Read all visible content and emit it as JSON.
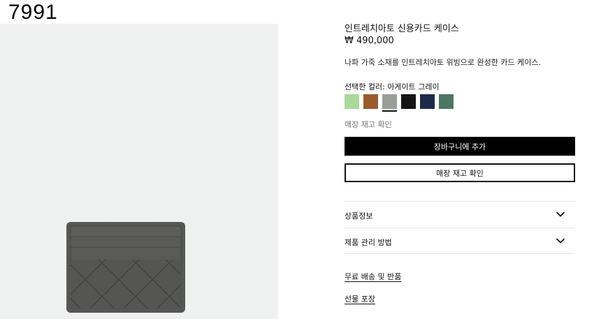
{
  "overlay_number": "7991",
  "product": {
    "title": "인트레치아토 신용카드 케이스",
    "price": "₩ 490,000",
    "description": "나파 가죽 소재를 인트레치아토 위빙으로 완성한 카드 케이스."
  },
  "color": {
    "label": "선택한 컬러:",
    "selected_name": "아게이트 그레이",
    "swatches": [
      {
        "color": "#a9d99a"
      },
      {
        "color": "#9a5a2b"
      },
      {
        "color": "#9b9d97"
      },
      {
        "color": "#151515"
      },
      {
        "color": "#1d2a4a"
      },
      {
        "color": "#4e7665"
      }
    ],
    "selected_index": 2
  },
  "stock_link": "매장 재고 확인",
  "buttons": {
    "add_to_cart": "장바구니에 추가",
    "check_store_stock": "매장 재고 확인"
  },
  "accordions": {
    "product_info": "상품정보",
    "care": "제품 관리 방법"
  },
  "links": {
    "shipping": "무료 배송 및 반품",
    "gift": "선물 포장"
  },
  "icons": {
    "accordion_toggle": "chevron-down-icon"
  },
  "image": {
    "background_color": "#eff1f0",
    "product_color": "#555654"
  }
}
